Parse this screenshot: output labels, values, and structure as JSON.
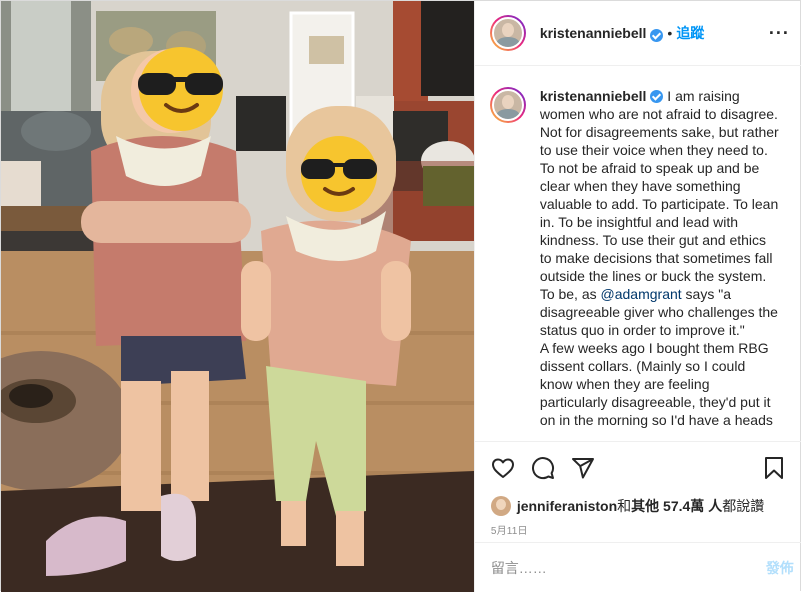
{
  "post": {
    "username": "kristenanniebell",
    "verified": true,
    "separator": "•",
    "follow_label": "追蹤",
    "more_label": "···",
    "caption_parts": [
      " I am raising women who are not afraid to disagree. Not for disagreements sake, but rather to use their voice when they need to. To not be afraid to speak up and be clear when they have something valuable to add. To participate. To lean in. To be insightful and lead with kindness. To use their gut and ethics to make decisions that sometimes fall outside the lines or buck the system. To be, as ",
      "@adamgrant",
      " says \"a disagreeable giver who challenges the status quo in order to improve it.\"",
      "A few weeks ago I bought them RBG dissent collars. (Mainly so I could know when they are feeling particularly disagreeable, they'd put it on in the morning so I'd have a heads"
    ],
    "likes": {
      "liker": "jenniferaniston",
      "middle": " 和 ",
      "others": "其他 57.4萬 人",
      "suffix": " 都說讚"
    },
    "date": "5月11日",
    "comment_placeholder": "留言……",
    "post_button": "發佈"
  },
  "icons": {
    "like": "heart-icon",
    "comment": "comment-icon",
    "share": "paper-plane-icon",
    "save": "bookmark-icon"
  },
  "colors": {
    "accent": "#0095f6",
    "verified": "#3897f0",
    "mention": "#00376b",
    "post_disabled": "#b2dffc",
    "muted": "#8e8e8e"
  }
}
